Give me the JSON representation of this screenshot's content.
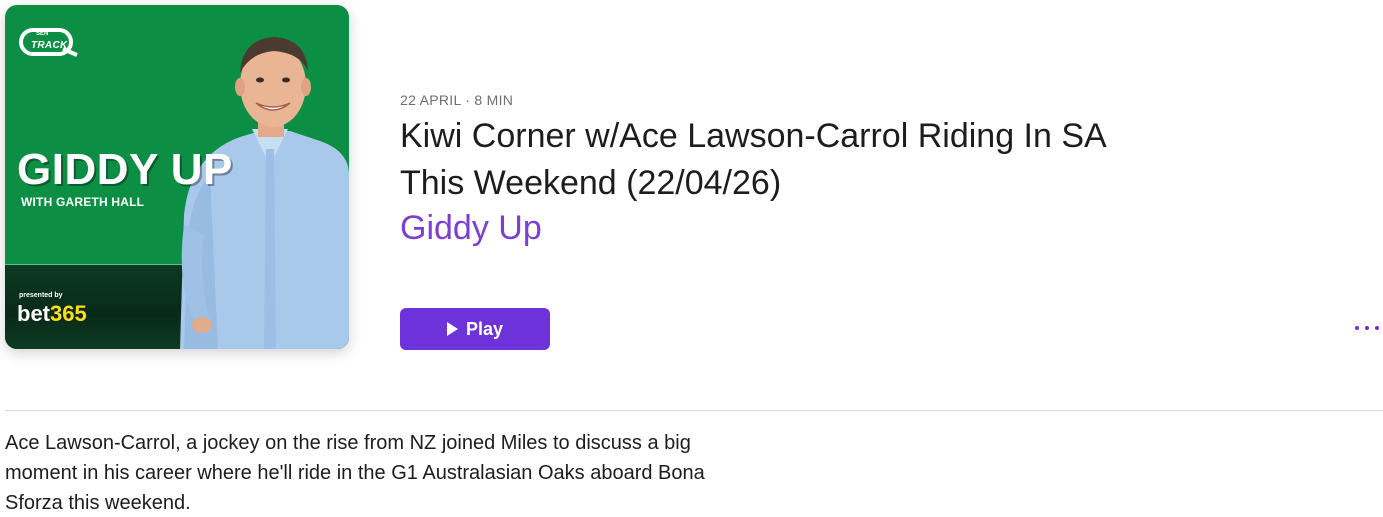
{
  "artwork": {
    "logo_small": "SEN",
    "logo_text": "TRACK",
    "title": "GIDDY UP",
    "subtitle": "WITH GARETH HALL",
    "presented_by": "presented by",
    "brand_part1": "bet",
    "brand_part2": "365",
    "colors": {
      "background": "#0c8f45",
      "brand_highlight": "#ffdf1b"
    }
  },
  "episode": {
    "meta": "22 APRIL · 8 MIN",
    "title": "Kiwi Corner w/Ace Lawson-Carrol Riding In SA This Weekend (22/04/26)",
    "show_name": "Giddy Up",
    "play_label": "Play",
    "description": "Ace Lawson-Carrol, a jockey on the rise from NZ joined Miles to discuss a big moment in his career where he'll ride in the G1 Australasian Oaks aboard Bona Sforza this weekend."
  },
  "icons": {
    "play": "play-icon",
    "more": "more-icon"
  },
  "colors": {
    "accent": "#6e32db",
    "link": "#7b3fd6",
    "meta_text": "#6e6e73"
  }
}
